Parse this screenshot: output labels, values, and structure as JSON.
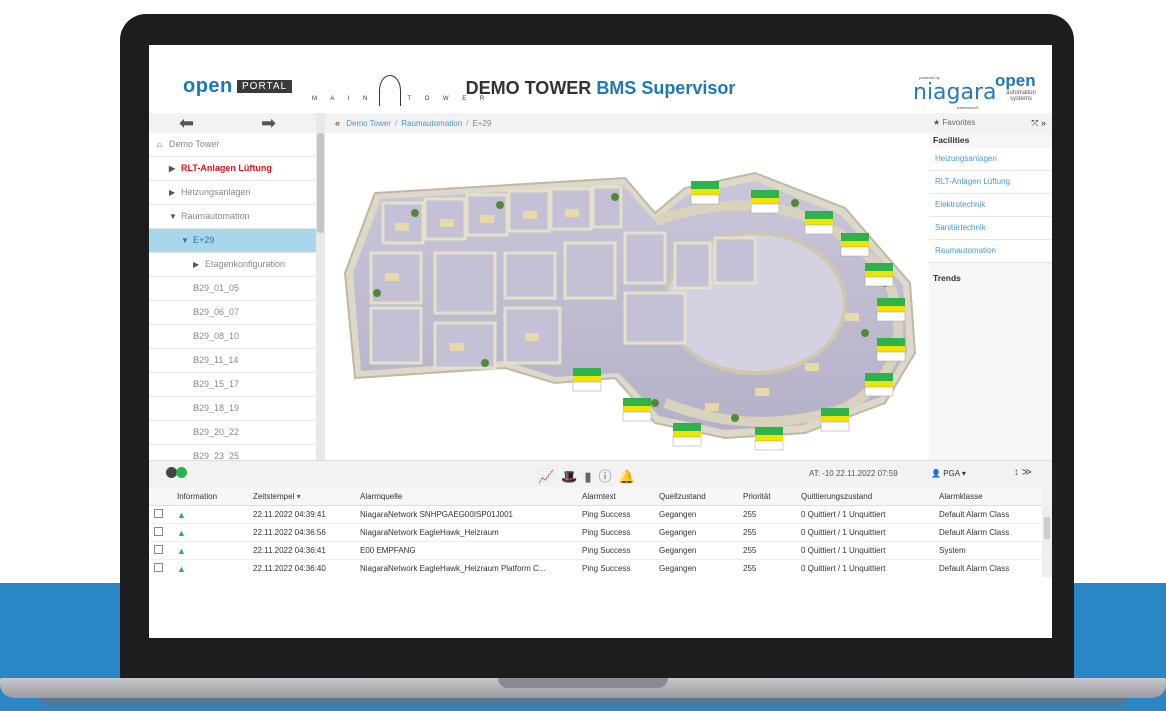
{
  "header": {
    "logo_open": "open",
    "logo_portal": "PORTAL",
    "logo_main_left": "M A I N",
    "logo_main_right": "T O W E R",
    "title_a": "DEMO TOWER ",
    "title_b": "BMS Supervisor",
    "niagara_powered": "powered by",
    "niagara": "niagara",
    "niagara_fw": "framework®",
    "oas_open": "open",
    "oas_sub": "automation systems"
  },
  "colors": {
    "accent": "#1e77b7",
    "alarm_red": "#e0121f",
    "ok_green": "#2db34a",
    "selected_row": "#a9d7ea",
    "laptop_backdrop": "#2b86c5"
  },
  "nav": {
    "back_icon": "arrow-left-icon",
    "forward_icon": "arrow-right-icon"
  },
  "tree": {
    "root": "Demo Tower",
    "items": [
      {
        "label": "RLT-Anlagen Lüftung",
        "glyph": "▶"
      },
      {
        "label": "Heizungsanlagen",
        "glyph": "▶"
      },
      {
        "label": "Raumautomation",
        "glyph": "▼"
      },
      {
        "label": "E+29",
        "glyph": "▼"
      },
      {
        "label": "Etagenkonfiguration",
        "glyph": "▶"
      },
      {
        "label": "B29_01_05"
      },
      {
        "label": "B29_06_07"
      },
      {
        "label": "B29_08_10"
      },
      {
        "label": "B29_11_14"
      },
      {
        "label": "B29_15_17"
      },
      {
        "label": "B29_18_19"
      },
      {
        "label": "B29_20_22"
      },
      {
        "label": "B29_23_25"
      }
    ]
  },
  "breadcrumb": {
    "c1": "Demo Tower",
    "c2": "Raumautomation",
    "c3": "E+29",
    "sep": "/"
  },
  "right": {
    "favorites": "Favorites",
    "facilities_heading": "Facilities",
    "facilities": [
      "Heizungsanlagen",
      "RLT-Anlagen Lüftung",
      "Elektrotechnik",
      "Sanitärtechnik",
      "Raumautomation"
    ],
    "trends_heading": "Trends"
  },
  "alarm_toolbar": {
    "time": "AT: -10   22.11.2022 07:59",
    "user": "PGA ▾",
    "sort": "↕ ≫"
  },
  "alarm_table": {
    "headers": [
      "Information",
      "Zeitstempel",
      "Alarmquelle",
      "Alarmtext",
      "Quellzustand",
      "Priorität",
      "Quittierungszustand",
      "Alarmklasse"
    ],
    "rows": [
      [
        "22.11.2022 04:39:41",
        "NiagaraNetwork SNHPGAEG00ISP01J001",
        "Ping Success",
        "Gegangen",
        "255",
        "0 Quittiert / 1 Unquittiert",
        "Default Alarm Class"
      ],
      [
        "22.11.2022 04:36:56",
        "NiagaraNetwork EagleHawk_Heizraum",
        "Ping Success",
        "Gegangen",
        "255",
        "0 Quittiert / 1 Unquittiert",
        "Default Alarm Class"
      ],
      [
        "22.11.2022 04:36:41",
        "E00 EMPFANG",
        "Ping Success",
        "Gegangen",
        "255",
        "0 Quittiert / 1 Unquittiert",
        "System"
      ],
      [
        "22.11.2022 04:36:40",
        "NiagaraNetwork EagleHawk_Heizraum Platform C...",
        "Ping Success",
        "Gegangen",
        "255",
        "0 Quittiert / 1 Unquittiert",
        "Default Alarm Class"
      ]
    ]
  }
}
